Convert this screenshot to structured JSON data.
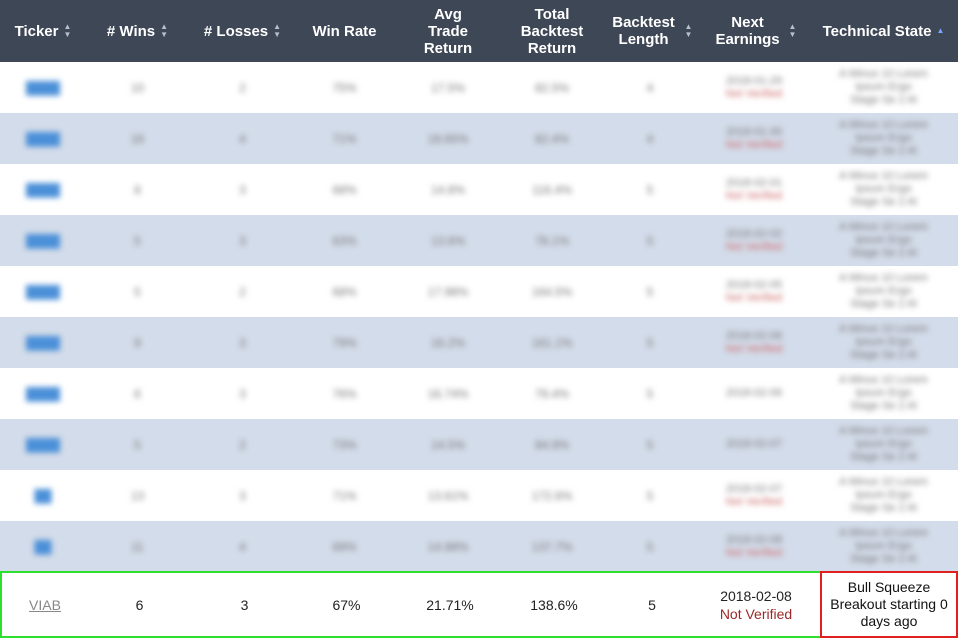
{
  "columns": [
    {
      "label": "Ticker"
    },
    {
      "label": "# Wins"
    },
    {
      "label": "# Losses"
    },
    {
      "label": "Win Rate"
    },
    {
      "label": "Avg Trade Return"
    },
    {
      "label": "Total Backtest Return"
    },
    {
      "label": "Backtest Length"
    },
    {
      "label": "Next Earnings"
    },
    {
      "label": "Technical State",
      "sorted": "ascending"
    }
  ],
  "blurred_rows": [
    {
      "ticker": "████",
      "wins": "10",
      "losses": "2",
      "win_rate": "75%",
      "avg": "17.5%",
      "total": "82.5%",
      "length": "4",
      "earn1": "2018-01-29",
      "earn2": "Not Verified",
      "tech": [
        "A Minus 10 Lorem",
        "Ipsum Ergo",
        "Stage Se 2 Al"
      ]
    },
    {
      "ticker": "████",
      "wins": "16",
      "losses": "4",
      "win_rate": "71%",
      "avg": "18.65%",
      "total": "82.4%",
      "length": "4",
      "earn1": "2018-01-30",
      "earn2": "Not Verified",
      "tech": [
        "A Minus 10 Lorem",
        "Ipsum Ergo",
        "Stage Se 2 Al"
      ]
    },
    {
      "ticker": "████",
      "wins": "8",
      "losses": "3",
      "win_rate": "68%",
      "avg": "14.8%",
      "total": "116.4%",
      "length": "5",
      "earn1": "2018-02-01",
      "earn2": "Not Verified",
      "tech": [
        "A Minus 10 Lorem",
        "Ipsum Ergo",
        "Stage Se 2 Al"
      ]
    },
    {
      "ticker": "████",
      "wins": "5",
      "losses": "3",
      "win_rate": "63%",
      "avg": "13.6%",
      "total": "78.1%",
      "length": "5",
      "earn1": "2018-02-02",
      "earn2": "Not Verified",
      "tech": [
        "A Minus 10 Lorem",
        "Ipsum Ergo",
        "Stage Se 2 Al"
      ]
    },
    {
      "ticker": "████",
      "wins": "5",
      "losses": "2",
      "win_rate": "68%",
      "avg": "17.98%",
      "total": "164.5%",
      "length": "5",
      "earn1": "2018-02-05",
      "earn2": "Not Verified",
      "tech": [
        "A Minus 10 Lorem",
        "Ipsum Ergo",
        "Stage Se 2 Al"
      ]
    },
    {
      "ticker": "████",
      "wins": "9",
      "losses": "3",
      "win_rate": "79%",
      "avg": "16.2%",
      "total": "161.1%",
      "length": "5",
      "earn1": "2018-02-06",
      "earn2": "Not Verified",
      "tech": [
        "A Minus 10 Lorem",
        "Ipsum Ergo",
        "Stage Se 2 Al"
      ]
    },
    {
      "ticker": "████",
      "wins": "6",
      "losses": "3",
      "win_rate": "76%",
      "avg": "16.74%",
      "total": "79.4%",
      "length": "5",
      "earn1": "2018-02-06",
      "earn2": "",
      "tech": [
        "A Minus 10 Lorem",
        "Ipsum Ergo",
        "Stage Se 2 Al"
      ]
    },
    {
      "ticker": "████",
      "wins": "5",
      "losses": "2",
      "win_rate": "73%",
      "avg": "14.5%",
      "total": "84.9%",
      "length": "5",
      "earn1": "2018-02-07",
      "earn2": "",
      "tech": [
        "A Minus 10 Lorem",
        "Ipsum Ergo",
        "Stage Se 2 Al"
      ]
    },
    {
      "ticker": "██",
      "wins": "13",
      "losses": "3",
      "win_rate": "71%",
      "avg": "13.61%",
      "total": "172.6%",
      "length": "5",
      "earn1": "2018-02-07",
      "earn2": "Not Verified",
      "tech": [
        "A Minus 10 Lorem",
        "Ipsum Ergo",
        "Stage Se 2 Al"
      ]
    },
    {
      "ticker": "██",
      "wins": "11",
      "losses": "4",
      "win_rate": "69%",
      "avg": "14.98%",
      "total": "137.7%",
      "length": "5",
      "earn1": "2018-02-08",
      "earn2": "Not Verified",
      "tech": [
        "A Minus 10 Lorem",
        "Ipsum Ergo",
        "Stage Se 2 Al"
      ]
    }
  ],
  "highlight_row": {
    "ticker": "VIAB",
    "wins": "6",
    "losses": "3",
    "win_rate": "67%",
    "avg_trade_return": "21.71%",
    "total_backtest_return": "138.6%",
    "backtest_length": "5",
    "next_earnings_date": "2018-02-08",
    "next_earnings_status": "Not Verified",
    "technical_state": "Bull Squeeze Breakout starting 0 days ago"
  },
  "colors": {
    "header_bg": "#3e4756",
    "alt_row_bg": "#d3dcea",
    "highlight_border": "#2ee02e",
    "technical_state_border": "#e02020",
    "not_verified": "#9b2a2a"
  }
}
